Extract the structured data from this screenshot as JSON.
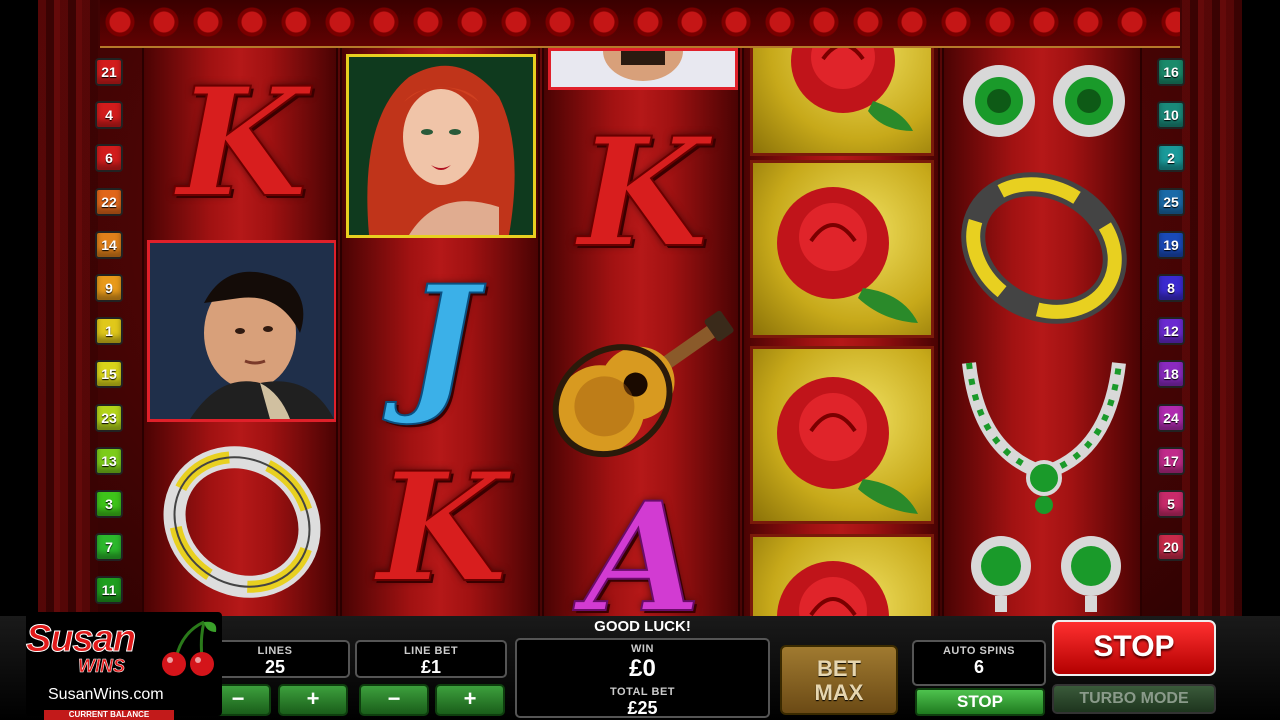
{
  "paylines": {
    "left": [
      {
        "n": "21",
        "color": "#d21c1c"
      },
      {
        "n": "4",
        "color": "#d21c1c"
      },
      {
        "n": "6",
        "color": "#d21c1c"
      },
      {
        "n": "22",
        "color": "#e0661a"
      },
      {
        "n": "14",
        "color": "#e0801a"
      },
      {
        "n": "9",
        "color": "#e89a1a"
      },
      {
        "n": "1",
        "color": "#e0c81a"
      },
      {
        "n": "15",
        "color": "#d8d41a"
      },
      {
        "n": "23",
        "color": "#b4d41a"
      },
      {
        "n": "13",
        "color": "#7ccc1a"
      },
      {
        "n": "3",
        "color": "#3ec41a"
      },
      {
        "n": "7",
        "color": "#2cb82c"
      },
      {
        "n": "11",
        "color": "#1e9e1e"
      }
    ],
    "right": [
      {
        "n": "16",
        "color": "#1a8a6a"
      },
      {
        "n": "10",
        "color": "#1a8a7a"
      },
      {
        "n": "2",
        "color": "#1a9a9a"
      },
      {
        "n": "25",
        "color": "#1a6aa8"
      },
      {
        "n": "19",
        "color": "#1a4ab8"
      },
      {
        "n": "8",
        "color": "#3a2ad0"
      },
      {
        "n": "12",
        "color": "#6a2ad0"
      },
      {
        "n": "18",
        "color": "#8a2ac0"
      },
      {
        "n": "24",
        "color": "#b02ab0"
      },
      {
        "n": "17",
        "color": "#c02a8a"
      },
      {
        "n": "5",
        "color": "#c82a6a"
      },
      {
        "n": "20",
        "color": "#c82a4a"
      }
    ]
  },
  "reels": {
    "reel1": [
      "K",
      "man-portrait",
      "tambourine"
    ],
    "reel2": [
      "woman-portrait",
      "J",
      "K"
    ],
    "reel3": [
      "man-portrait-partial",
      "K",
      "guitar",
      "A"
    ],
    "reel4": [
      "rose",
      "rose",
      "rose",
      "rose"
    ],
    "reel5": [
      "green-earrings",
      "tambourine",
      "necklace",
      "green-earrings"
    ]
  },
  "letters": {
    "k": "K",
    "j": "J",
    "a": "A"
  },
  "message": "GOOD LUCK!",
  "controls": {
    "lines_label": "LINES",
    "lines_value": "25",
    "line_bet_label": "LINE BET",
    "line_bet_value": "£1",
    "minus": "−",
    "plus": "+",
    "win_label": "WIN",
    "win_value": "£0",
    "total_bet_label": "TOTAL BET",
    "total_bet_value": "£25",
    "bet_max_line1": "BET",
    "bet_max_line2": "MAX",
    "auto_spins_label": "AUTO SPINS",
    "auto_spins_value": "6",
    "stop_small": "STOP",
    "stop_big": "STOP",
    "turbo_mode": "TURBO MODE"
  },
  "logo": {
    "brand_line1": "Susan",
    "brand_line2": "WINS",
    "url": "SusanWins.com",
    "balance_label": "CURRENT BALANCE"
  }
}
